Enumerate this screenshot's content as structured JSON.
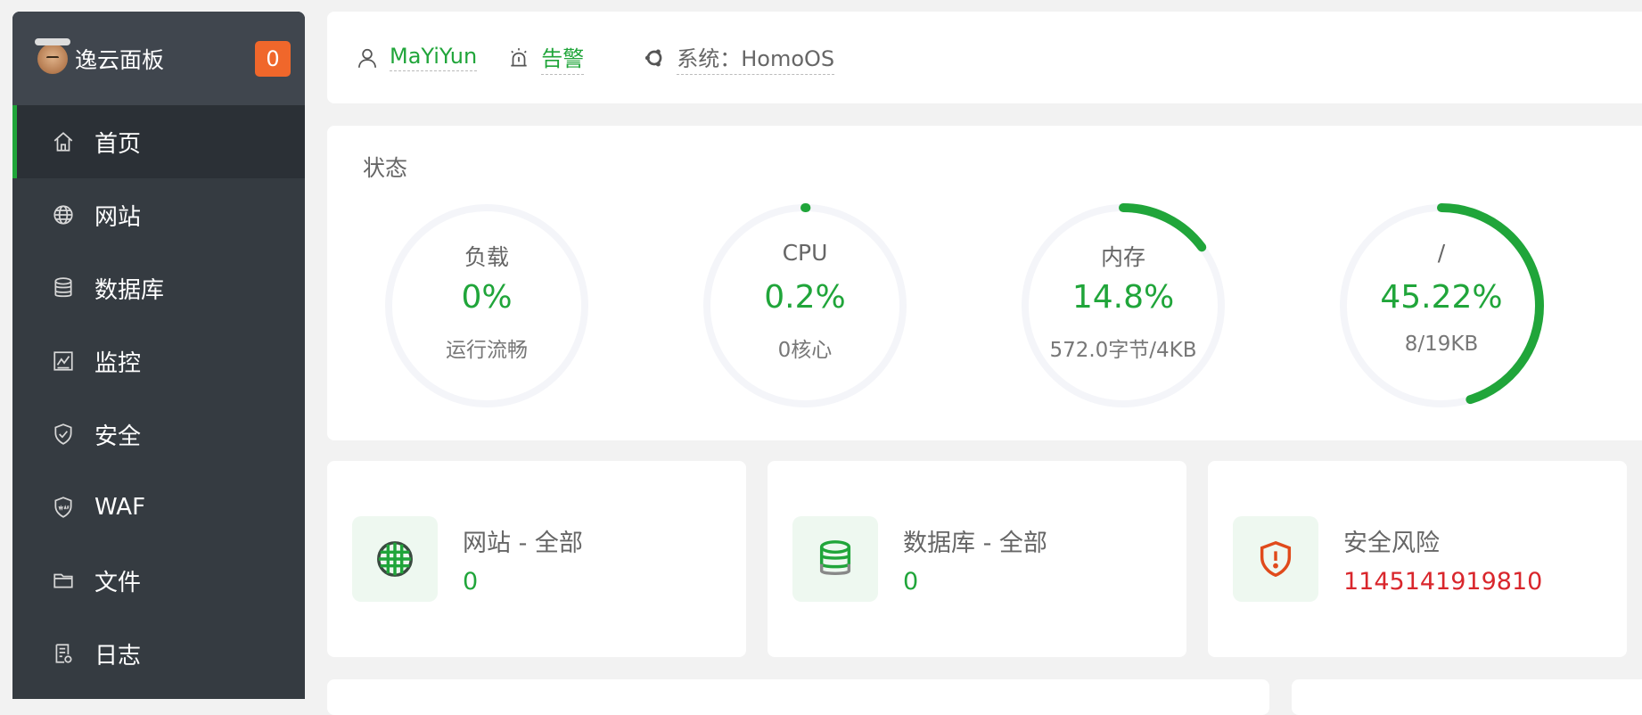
{
  "brand": {
    "title": "逸云面板",
    "badge": "0"
  },
  "sidebar": {
    "items": [
      {
        "label": "首页",
        "icon": "home-icon",
        "active": true
      },
      {
        "label": "网站",
        "icon": "globe-icon"
      },
      {
        "label": "数据库",
        "icon": "database-icon"
      },
      {
        "label": "监控",
        "icon": "monitor-icon"
      },
      {
        "label": "安全",
        "icon": "shield-check-icon"
      },
      {
        "label": "WAF",
        "icon": "waf-shield-icon"
      },
      {
        "label": "文件",
        "icon": "folder-icon"
      },
      {
        "label": "日志",
        "icon": "log-icon"
      }
    ]
  },
  "topbar": {
    "user": "MaYiYun",
    "alert": "告警",
    "system": "系统：HomoOS"
  },
  "status": {
    "title": "状态",
    "gauges": [
      {
        "label": "负载",
        "value": "0%",
        "sub": "运行流畅",
        "percent": 0
      },
      {
        "label": "CPU",
        "value": "0.2%",
        "sub": "0核心",
        "percent": 0.2
      },
      {
        "label": "内存",
        "value": "14.8%",
        "sub": "572.0字节/4KB",
        "percent": 14.8
      },
      {
        "label": "/",
        "value": "45.22%",
        "sub": "8/19KB",
        "percent": 45.22
      }
    ]
  },
  "cards": [
    {
      "title": "网站 - 全部",
      "value": "0",
      "icon": "globe-grid-icon"
    },
    {
      "title": "数据库 - 全部",
      "value": "0",
      "icon": "database-stack-icon"
    },
    {
      "title": "安全风险",
      "value": "1145141919810",
      "icon": "shield-alert-icon"
    }
  ],
  "colors": {
    "accent": "#20a53a",
    "danger": "#d9262c",
    "badge": "#f0672b",
    "sidebar": "#353b41"
  }
}
